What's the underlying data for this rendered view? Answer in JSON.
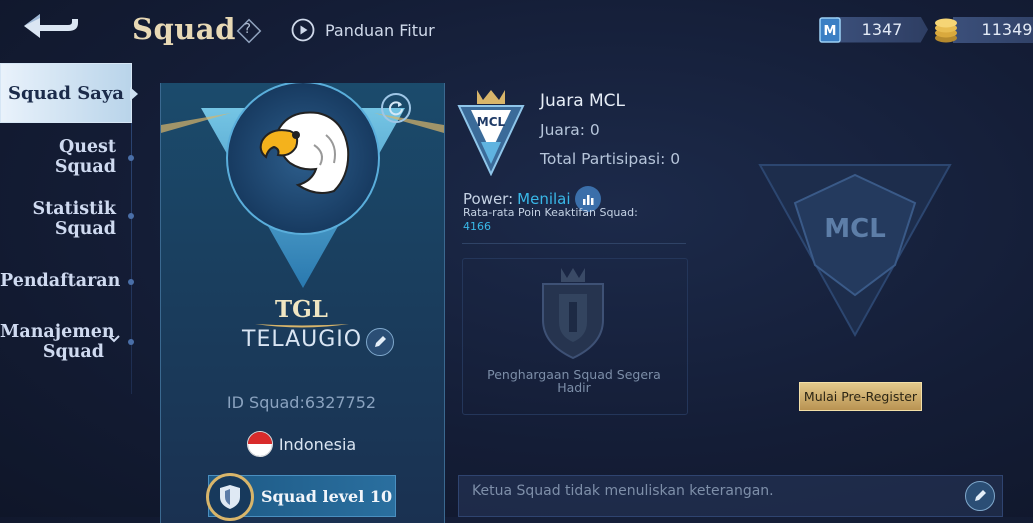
{
  "header": {
    "title": "Squad",
    "help_symbol": "?",
    "guide_label": "Panduan Fitur",
    "currency_tickets": "1347",
    "currency_coins": "11349"
  },
  "sidebar": {
    "items": [
      {
        "label": "Squad Saya",
        "active": true
      },
      {
        "label": "Quest Squad"
      },
      {
        "label": "Statistik Squad"
      },
      {
        "label": "Pendaftaran"
      },
      {
        "label": "Manajemen Squad"
      }
    ]
  },
  "squad": {
    "tag": "TGL",
    "name": "TELAUGIO",
    "id_text": "ID Squad:6327752",
    "country": "Indonesia",
    "level_label": "Squad level 10"
  },
  "mcl": {
    "logo_text": "MCL",
    "title": "Juara MCL",
    "champion": "Juara: 0",
    "participation": "Total Partisipasi: 0",
    "power_label": "Power:",
    "power_value": "Menilai",
    "avg_label": "Rata-rata Poin Keaktifan Squad:",
    "avg_value": "4166",
    "award_text": "Penghargaan Squad Segera Hadir",
    "big_logo_text": "MCL",
    "preregister_label": "Mulai Pre-Register"
  },
  "note": {
    "text": "Ketua Squad tidak menuliskan keterangan."
  },
  "colors": {
    "accent_blue": "#39b8e8",
    "gold": "#e3c98b",
    "background": "#141d36"
  }
}
